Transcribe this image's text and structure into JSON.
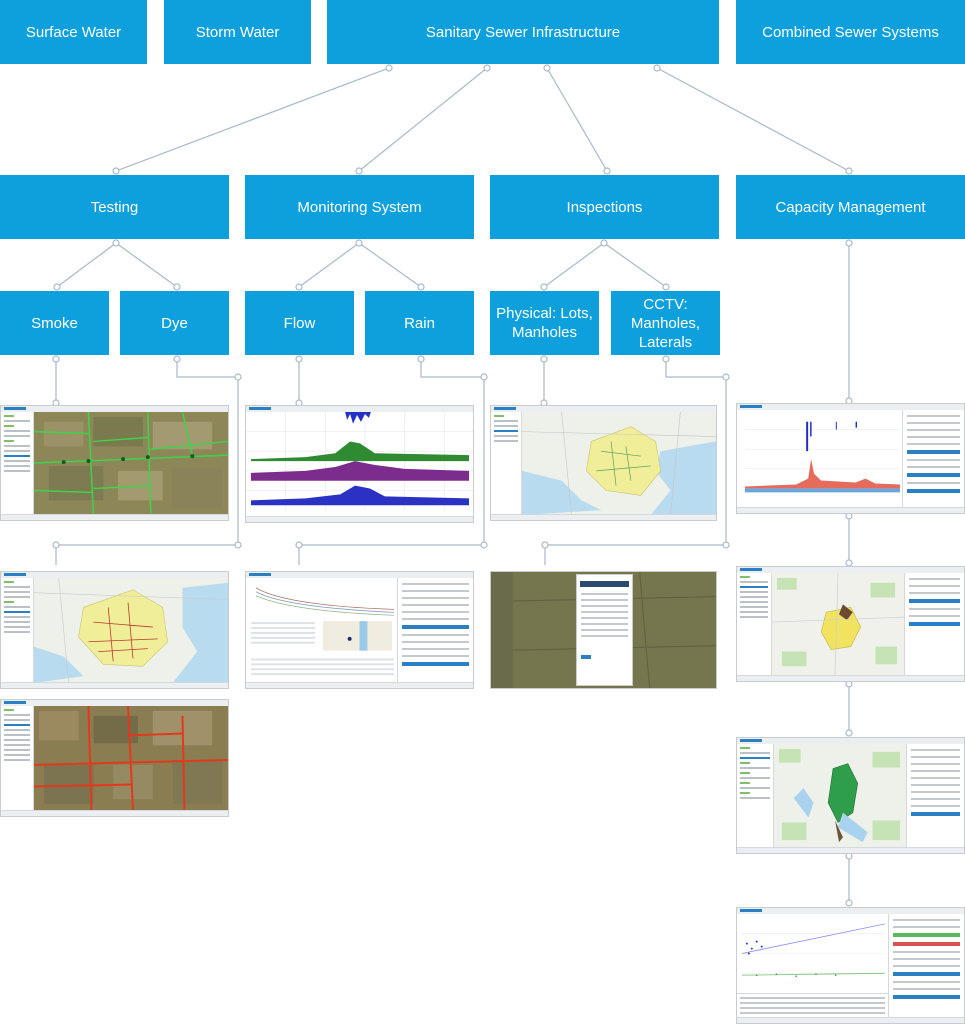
{
  "top_row": {
    "surface_water": "Surface Water",
    "storm_water": "Storm Water",
    "sanitary_sewer": "Sanitary Sewer Infrastructure",
    "combined_sewer": "Combined Sewer Systems"
  },
  "second_row": {
    "testing": "Testing",
    "monitoring": "Monitoring System",
    "inspections": "Inspections",
    "capacity": "Capacity Management"
  },
  "third_row": {
    "smoke": "Smoke",
    "dye": "Dye",
    "flow": "Flow",
    "rain": "Rain",
    "physical": "Physical: Lots, Manholes",
    "cctv": "CCTV: Manholes, Laterals"
  },
  "colors": {
    "node_fill": "#0da0dc",
    "node_text": "#ffffff",
    "connector": "#a9b9c8"
  },
  "screenshots": [
    "smoke-test-aerial-map",
    "smoke-dye-parcel-map",
    "dye-test-aerial-map",
    "flow-time-series-chart",
    "flow-analysis-report",
    "physical-inspection-map",
    "cctv-inspection-form",
    "capacity-rainfall-flow-chart",
    "capacity-sewershed-map",
    "capacity-catchment-map",
    "capacity-regression-plot"
  ]
}
